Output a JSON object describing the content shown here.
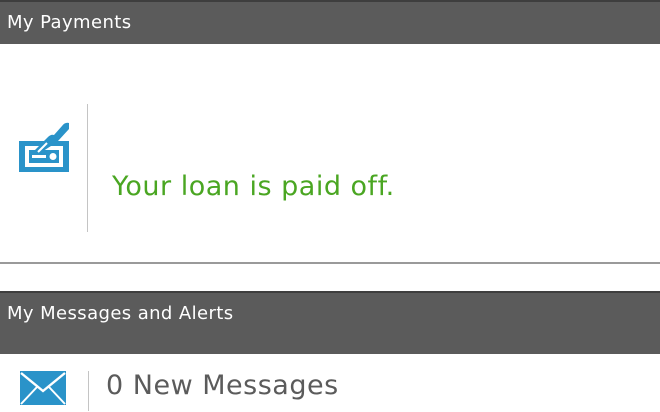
{
  "payments": {
    "header_title": "My Payments",
    "status_text": "Your loan is paid off.",
    "icon": "check-signing-icon"
  },
  "messages": {
    "header_title": "My Messages and Alerts",
    "count_text": "0 New Messages",
    "icon": "envelope-icon"
  },
  "colors": {
    "header_bg": "#5b5b5b",
    "header_text": "#ffffff",
    "success_green": "#4aa622",
    "icon_blue": "#2a93c9",
    "body_text": "#5b5b5b"
  }
}
